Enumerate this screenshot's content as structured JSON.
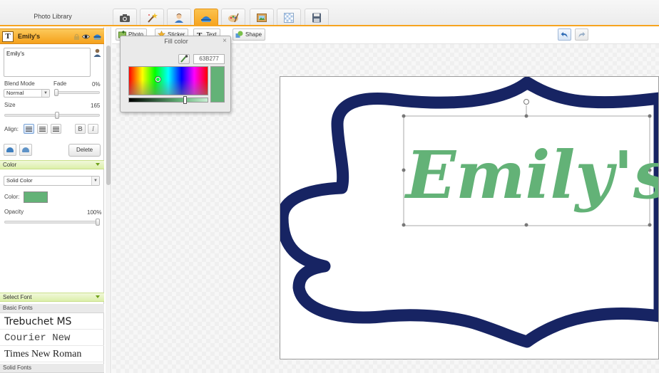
{
  "app": {
    "photo_library_label": "Photo Library"
  },
  "tabs": [
    {
      "icon": "camera-icon",
      "active": false
    },
    {
      "icon": "magic-wand-icon",
      "active": false
    },
    {
      "icon": "person-icon",
      "active": false
    },
    {
      "icon": "layers-icon",
      "active": true
    },
    {
      "icon": "paint-palette-icon",
      "active": false
    },
    {
      "icon": "picture-frame-icon",
      "active": false
    },
    {
      "icon": "transparency-grid-icon",
      "active": false
    },
    {
      "icon": "save-disk-icon",
      "active": false
    }
  ],
  "layer": {
    "name": "Emily's",
    "text_value": "Emily's"
  },
  "text_props": {
    "blend_mode_label": "Blend Mode",
    "blend_mode_value": "Normal",
    "fade_label": "Fade",
    "fade_value": "0%",
    "size_label": "Size",
    "size_value": "165",
    "align_label": "Align:",
    "bold_label": "B",
    "italic_label": "I",
    "delete_label": "Delete"
  },
  "color_section": {
    "header": "Color",
    "type_value": "Solid Color",
    "color_label": "Color:",
    "opacity_label": "Opacity",
    "opacity_value": "100%"
  },
  "font_section": {
    "header": "Select Font",
    "basic_fonts_label": "Basic Fonts",
    "fonts": [
      "Trebuchet MS",
      "Courier New",
      "Times New Roman"
    ],
    "solid_fonts_label": "Solid Fonts"
  },
  "toolbar": {
    "photo_label": "Photo",
    "sticker_label": "Sticker",
    "text_label": "Text",
    "shape_label": "Shape"
  },
  "fill_popup": {
    "title": "Fill color",
    "close_label": "×",
    "hex_value": "63B277"
  },
  "canvas": {
    "text": "Emily's",
    "text_color": "#63B277",
    "frame_color": "#172463"
  },
  "colors": {
    "accent": "#F6A41F",
    "selected_fill": "#63B277",
    "section_green": "#DCEFAA"
  }
}
